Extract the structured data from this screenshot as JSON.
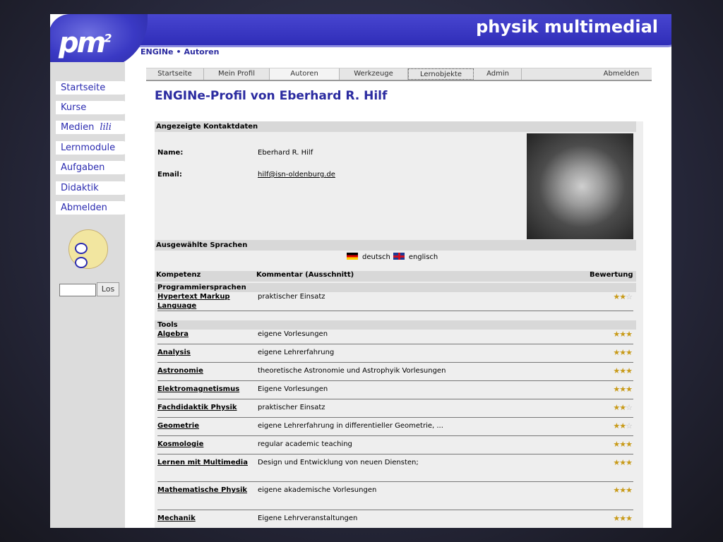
{
  "header": {
    "logo": "pm",
    "logo_sup": "2",
    "site_title": "physik multimedial",
    "breadcrumb": [
      "ENGINe",
      "•",
      "Autoren"
    ]
  },
  "sidebar": {
    "items": [
      {
        "label": "Startseite"
      },
      {
        "label": "Kurse"
      },
      {
        "label": "Medien",
        "badge": "lili"
      },
      {
        "label": "Lernmodule"
      },
      {
        "label": "Aufgaben"
      },
      {
        "label": "Didaktik"
      },
      {
        "label": "Abmelden"
      }
    ],
    "search_button": "Los"
  },
  "tabs": [
    {
      "label": "Startseite"
    },
    {
      "label": "Mein Profil"
    },
    {
      "label": "Autoren"
    },
    {
      "label": "Werkzeuge"
    },
    {
      "label": "Lernobjekte"
    },
    {
      "label": "Admin"
    },
    {
      "label": "Abmelden"
    }
  ],
  "page_title": "ENGINe-Profil von Eberhard R. Hilf",
  "contact": {
    "section_title": "Angezeigte Kontaktdaten",
    "name_label": "Name:",
    "name_value": "Eberhard R. Hilf",
    "email_label": "Email:",
    "email_value": "hilf@isn-oldenburg.de"
  },
  "languages": {
    "section_title": "Ausgewählte Sprachen",
    "items": [
      "deutsch",
      "englisch"
    ]
  },
  "competences": {
    "columns": [
      "Kompetenz",
      "Kommentar (Ausschnitt)",
      "Bewertung"
    ],
    "groups": [
      {
        "title": "Programmiersprachen",
        "rows": [
          {
            "name": "Hypertext Markup Language",
            "comment": "praktischer Einsatz",
            "rating": 2
          }
        ]
      },
      {
        "title": "Tools",
        "rows": [
          {
            "name": "Algebra",
            "comment": "eigene Vorlesungen",
            "rating": 3
          },
          {
            "name": "Analysis",
            "comment": "eigene Lehrerfahrung",
            "rating": 3
          },
          {
            "name": "Astronomie",
            "comment": "theoretische Astronomie und Astrophyik Vorlesungen",
            "rating": 3
          },
          {
            "name": "Elektromagnetismus",
            "comment": "Eigene Vorlesungen",
            "rating": 3
          },
          {
            "name": "Fachdidaktik Physik",
            "comment": "praktischer Einsatz",
            "rating": 2
          },
          {
            "name": "Geometrie",
            "comment": "eigene Lehrerfahrung in differentieller Geometrie, ...",
            "rating": 2
          },
          {
            "name": "Kosmologie",
            "comment": "regular academic teaching",
            "rating": 3
          },
          {
            "name": "Lernen mit Multimedia",
            "comment": "Design und Entwicklung von neuen Diensten;",
            "rating": 3
          },
          {
            "name": "Mathematische Physik",
            "comment": "eigene akademische Vorlesungen",
            "rating": 3
          },
          {
            "name": "Mechanik",
            "comment": "Eigene Lehrveranstaltungen",
            "rating": 3
          }
        ]
      }
    ]
  }
}
